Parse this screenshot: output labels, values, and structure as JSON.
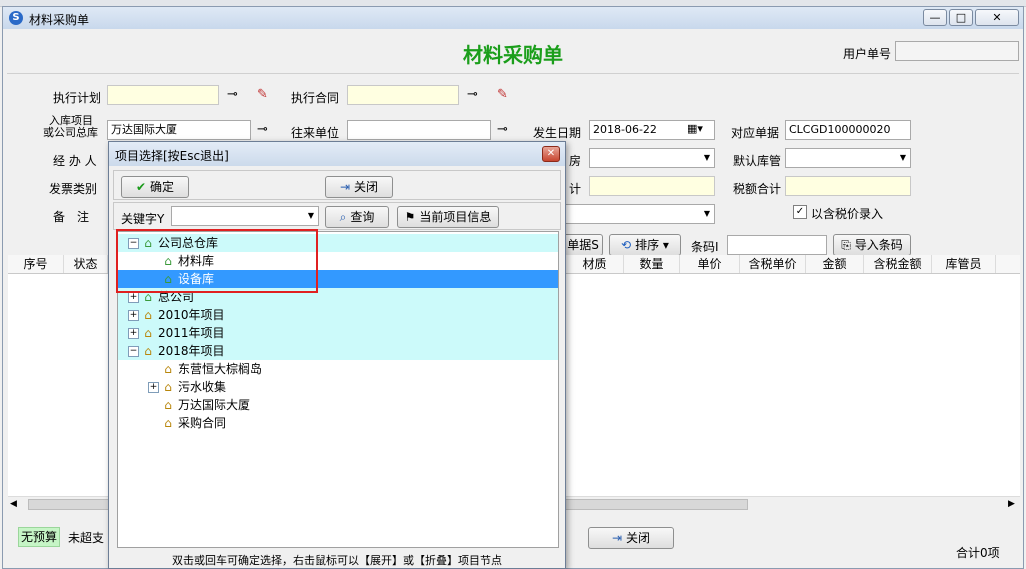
{
  "window": {
    "title": "材料采购单",
    "controls": {
      "minimize": "—",
      "restore": "□",
      "close": "✕"
    }
  },
  "header": {
    "form_title": "材料采购单",
    "user_no_label": "用户单号",
    "user_no_value": ""
  },
  "form": {
    "exec_plan_label": "执行计划",
    "exec_contract_label": "执行合同",
    "project_label_line1": "入库项目",
    "project_label_line2": "或公司总库",
    "project_value": "万达国际大厦",
    "partner_label": "往来单位",
    "date_label": "发生日期",
    "date_value": "2018-06-22",
    "doc_label": "对应单据",
    "doc_value": "CLCGD100000020",
    "handler_label": "经 办 人",
    "warehouse_label": "房",
    "keeper_label": "默认库管",
    "invoice_label": "发票类别",
    "total_label": "计",
    "tax_total_label": "税额合计",
    "remark_label": "备　注",
    "tax_checkbox_label": "以含税价录入",
    "tax_checkbox_checked": true
  },
  "toolbar": {
    "detail_btn": "单据S",
    "sort_btn": "排序",
    "barcode_label": "条码I",
    "import_barcode_btn": "导入条码"
  },
  "grid": {
    "columns_left": [
      "序号",
      "状态"
    ],
    "columns_right": [
      "材质",
      "数量",
      "单价",
      "含税单价",
      "金额",
      "含税金额",
      "库管员"
    ]
  },
  "footer": {
    "badge_no_budget": "无预算",
    "not_exceed": "未超支",
    "close_btn": "关闭",
    "total_count": "合计0项"
  },
  "dialog": {
    "title": "项目选择[按Esc退出]",
    "confirm_btn": "确定",
    "close_btn": "关闭",
    "keyword_label": "关键字Y",
    "query_btn": "查询",
    "current_project_btn": "当前项目信息",
    "hint": "双击或回车可确定选择，右击鼠标可以【展开】或【折叠】项目节点",
    "tree": [
      {
        "label": "公司总仓库",
        "expander": "−",
        "icon": "green",
        "level": 0,
        "state": "hl"
      },
      {
        "label": "材料库",
        "expander": "",
        "icon": "green",
        "level": 1,
        "state": ""
      },
      {
        "label": "设备库",
        "expander": "",
        "icon": "green",
        "level": 1,
        "state": "sel"
      },
      {
        "label": "总公司",
        "expander": "+",
        "icon": "green",
        "level": 0,
        "state": "hl"
      },
      {
        "label": "2010年项目",
        "expander": "+",
        "icon": "gold",
        "level": 0,
        "state": "hl"
      },
      {
        "label": "2011年项目",
        "expander": "+",
        "icon": "gold",
        "level": 0,
        "state": "hl"
      },
      {
        "label": "2018年项目",
        "expander": "−",
        "icon": "gold",
        "level": 0,
        "state": "hl"
      },
      {
        "label": "东营恒大棕榈岛",
        "expander": "",
        "icon": "gold",
        "level": 1,
        "state": ""
      },
      {
        "label": "污水收集",
        "expander": "+",
        "icon": "gold",
        "level": 1,
        "state": ""
      },
      {
        "label": "万达国际大厦",
        "expander": "",
        "icon": "gold",
        "level": 1,
        "state": ""
      },
      {
        "label": "采购合同",
        "expander": "",
        "icon": "gold",
        "level": 1,
        "state": ""
      }
    ]
  },
  "colors": {
    "title_green": "#1b9e1b",
    "highlight_cyan": "#ccfafa",
    "selection_blue": "#3399ff",
    "annotation_red": "#e02020"
  }
}
